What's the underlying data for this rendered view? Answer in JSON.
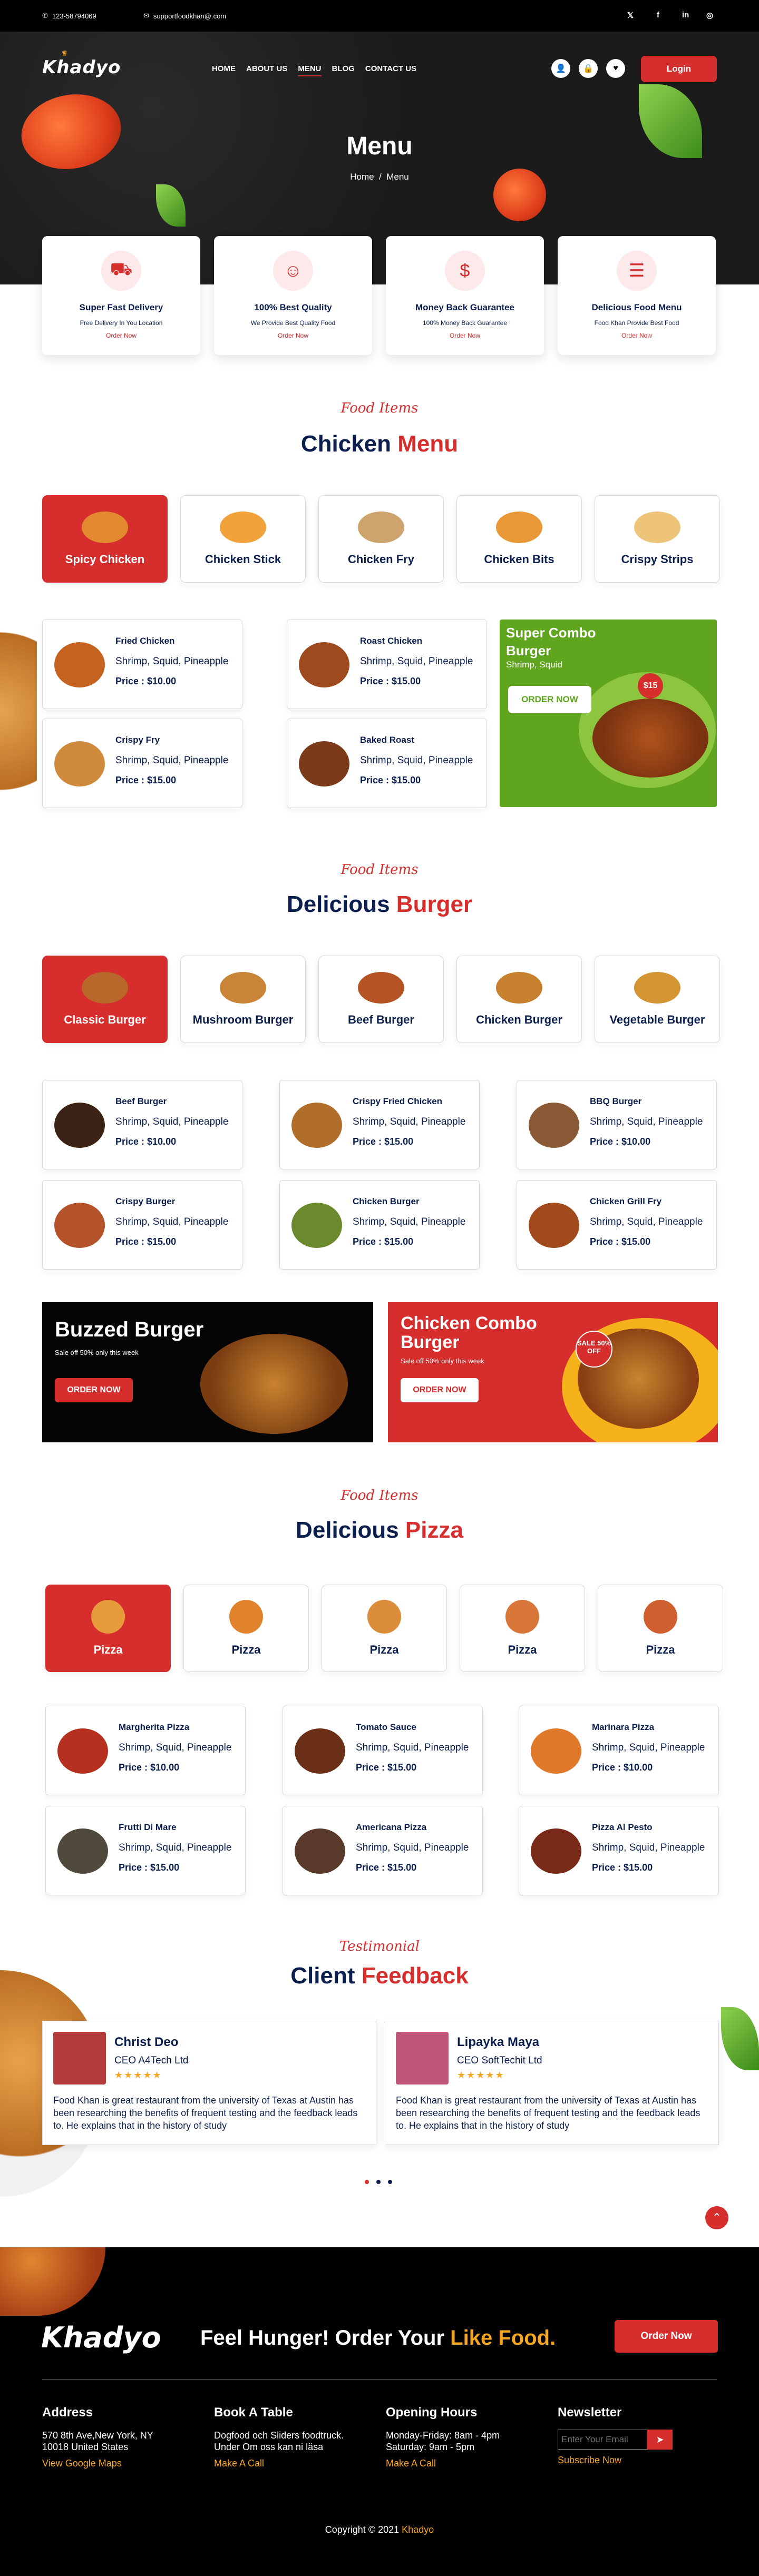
{
  "topbar": {
    "phone": "123-58794069",
    "email": "supportfoodkhan@.com",
    "social": [
      "twitter-icon",
      "facebook-icon",
      "linkedin-icon",
      "instagram-icon"
    ]
  },
  "header": {
    "logo": "Khadyo",
    "nav": [
      "HOME",
      "ABOUT US",
      "MENU",
      "BLOG",
      "CONTACT US"
    ],
    "active_nav": "MENU",
    "login": "Login"
  },
  "hero": {
    "title": "Menu",
    "crumb_home": "Home",
    "crumb_sep": "/",
    "crumb_current": "Menu"
  },
  "features": [
    {
      "title": "Super Fast Delivery",
      "text": "Free Delivery In You Location",
      "link": "Order Now",
      "icon": "delivery-icon"
    },
    {
      "title": "100% Best Quality",
      "text": "We Provide Best Quality Food",
      "link": "Order Now",
      "icon": "chef-icon"
    },
    {
      "title": "Money Back Guarantee",
      "text": "100% Money Back Guarantee",
      "link": "Order Now",
      "icon": "money-icon"
    },
    {
      "title": "Delicious Food Menu",
      "text": "Food Khan Provide Best Food",
      "link": "Order Now",
      "icon": "menu-icon"
    }
  ],
  "chicken": {
    "eyebrow": "Food Items",
    "title_a": "Chicken",
    "title_b": "Menu",
    "tabs": [
      "Spicy Chicken",
      "Chicken Stick",
      "Chicken Fry",
      "Chicken Bits",
      "Crispy Strips"
    ],
    "items": [
      {
        "name": "Fried Chicken",
        "desc": "Shrimp, Squid, Pineapple",
        "price": "Price : $10.00"
      },
      {
        "name": "Roast Chicken",
        "desc": "Shrimp, Squid, Pineapple",
        "price": "Price : $15.00"
      },
      {
        "name": "Crispy Fry",
        "desc": "Shrimp, Squid, Pineapple",
        "price": "Price : $15.00"
      },
      {
        "name": "Baked Roast",
        "desc": "Shrimp, Squid, Pineapple",
        "price": "Price : $15.00"
      }
    ],
    "promo": {
      "title": "Super Combo Burger",
      "sub": "Shrimp, Squid",
      "button": "ORDER NOW",
      "price": "$15"
    }
  },
  "burger": {
    "eyebrow": "Food Items",
    "title_a": "Delicious",
    "title_b": "Burger",
    "tabs": [
      "Classic Burger",
      "Mushroom Burger",
      "Beef Burger",
      "Chicken Burger",
      "Vegetable Burger"
    ],
    "items": [
      {
        "name": "Beef Burger",
        "desc": "Shrimp, Squid, Pineapple",
        "price": "Price : $10.00"
      },
      {
        "name": "Crispy Fried Chicken",
        "desc": "Shrimp, Squid, Pineapple",
        "price": "Price : $15.00"
      },
      {
        "name": "BBQ Burger",
        "desc": "Shrimp, Squid, Pineapple",
        "price": "Price : $10.00"
      },
      {
        "name": "Crispy Burger",
        "desc": "Shrimp, Squid, Pineapple",
        "price": "Price : $15.00"
      },
      {
        "name": "Chicken Burger",
        "desc": "Shrimp, Squid, Pineapple",
        "price": "Price : $15.00"
      },
      {
        "name": "Chicken Grill Fry",
        "desc": "Shrimp, Squid, Pineapple",
        "price": "Price : $15.00"
      }
    ],
    "banners": [
      {
        "title": "Buzzed Burger",
        "sub": "Sale off 50% only this week",
        "button": "ORDER NOW"
      },
      {
        "title": "Chicken Combo Burger",
        "sub": "Sale off 50% only this week",
        "button": "ORDER NOW",
        "badge": "SALE 50% OFF"
      }
    ]
  },
  "pizza": {
    "eyebrow": "Food Items",
    "title_a": "Delicious",
    "title_b": "Pizza",
    "tabs": [
      "Pizza",
      "Pizza",
      "Pizza",
      "Pizza",
      "Pizza"
    ],
    "items": [
      {
        "name": "Margherita Pizza",
        "desc": "Shrimp, Squid, Pineapple",
        "price": "Price : $10.00"
      },
      {
        "name": "Tomato Sauce",
        "desc": "Shrimp, Squid, Pineapple",
        "price": "Price : $15.00"
      },
      {
        "name": "Marinara Pizza",
        "desc": "Shrimp, Squid, Pineapple",
        "price": "Price : $10.00"
      },
      {
        "name": "Frutti Di Mare",
        "desc": "Shrimp, Squid, Pineapple",
        "price": "Price : $15.00"
      },
      {
        "name": "Americana Pizza",
        "desc": "Shrimp, Squid, Pineapple",
        "price": "Price : $15.00"
      },
      {
        "name": "Pizza Al Pesto",
        "desc": "Shrimp, Squid, Pineapple",
        "price": "Price : $15.00"
      }
    ]
  },
  "testimonial": {
    "eyebrow": "Testimonial",
    "title_a": "Client",
    "title_b": "Feedback",
    "stars": "★★★★★",
    "items": [
      {
        "name": "Christ Deo",
        "role": "CEO A4Tech Ltd",
        "text": "Food Khan is great restaurant from  the university of Texas at Austin has been researching the benefits of frequent testing and the feedback leads to. He explains that in the history of study"
      },
      {
        "name": "Lipayka Maya",
        "role": "CEO SoftTechit Ltd",
        "text": "Food Khan is great restaurant from  the university of Texas at Austin has been researching the benefits of frequent testing and the feedback leads to. He explains that in the history of study"
      }
    ]
  },
  "footer": {
    "logo": "Khadyo",
    "cta_a": "Feel Hunger! Order Your",
    "cta_b": "Like Food.",
    "cta_button": "Order Now",
    "address": {
      "heading": "Address",
      "text": "570 8th Ave,New York, NY 10018 United States",
      "link": "View Google Maps"
    },
    "table": {
      "heading": "Book A Table",
      "text": "Dogfood och Sliders foodtruck. Under Om oss kan ni läsa",
      "link": "Make A Call"
    },
    "hours": {
      "heading": "Opening Hours",
      "text": "Monday-Friday: 8am - 4pm Saturday: 9am - 5pm",
      "link": "Make A Call"
    },
    "newsletter": {
      "heading": "Newsletter",
      "placeholder": "Enter Your Email",
      "link": "Subscribe Now"
    },
    "copy_a": "Copyright",
    "copy_symbol": "©",
    "copy_year": "2021",
    "copy_brand": "Khadyo"
  },
  "colors": {
    "brand_red": "#d62d2d",
    "navy": "#0b1f4f",
    "accent_yellow": "#f5a623",
    "promo_green": "#5fa51e"
  }
}
